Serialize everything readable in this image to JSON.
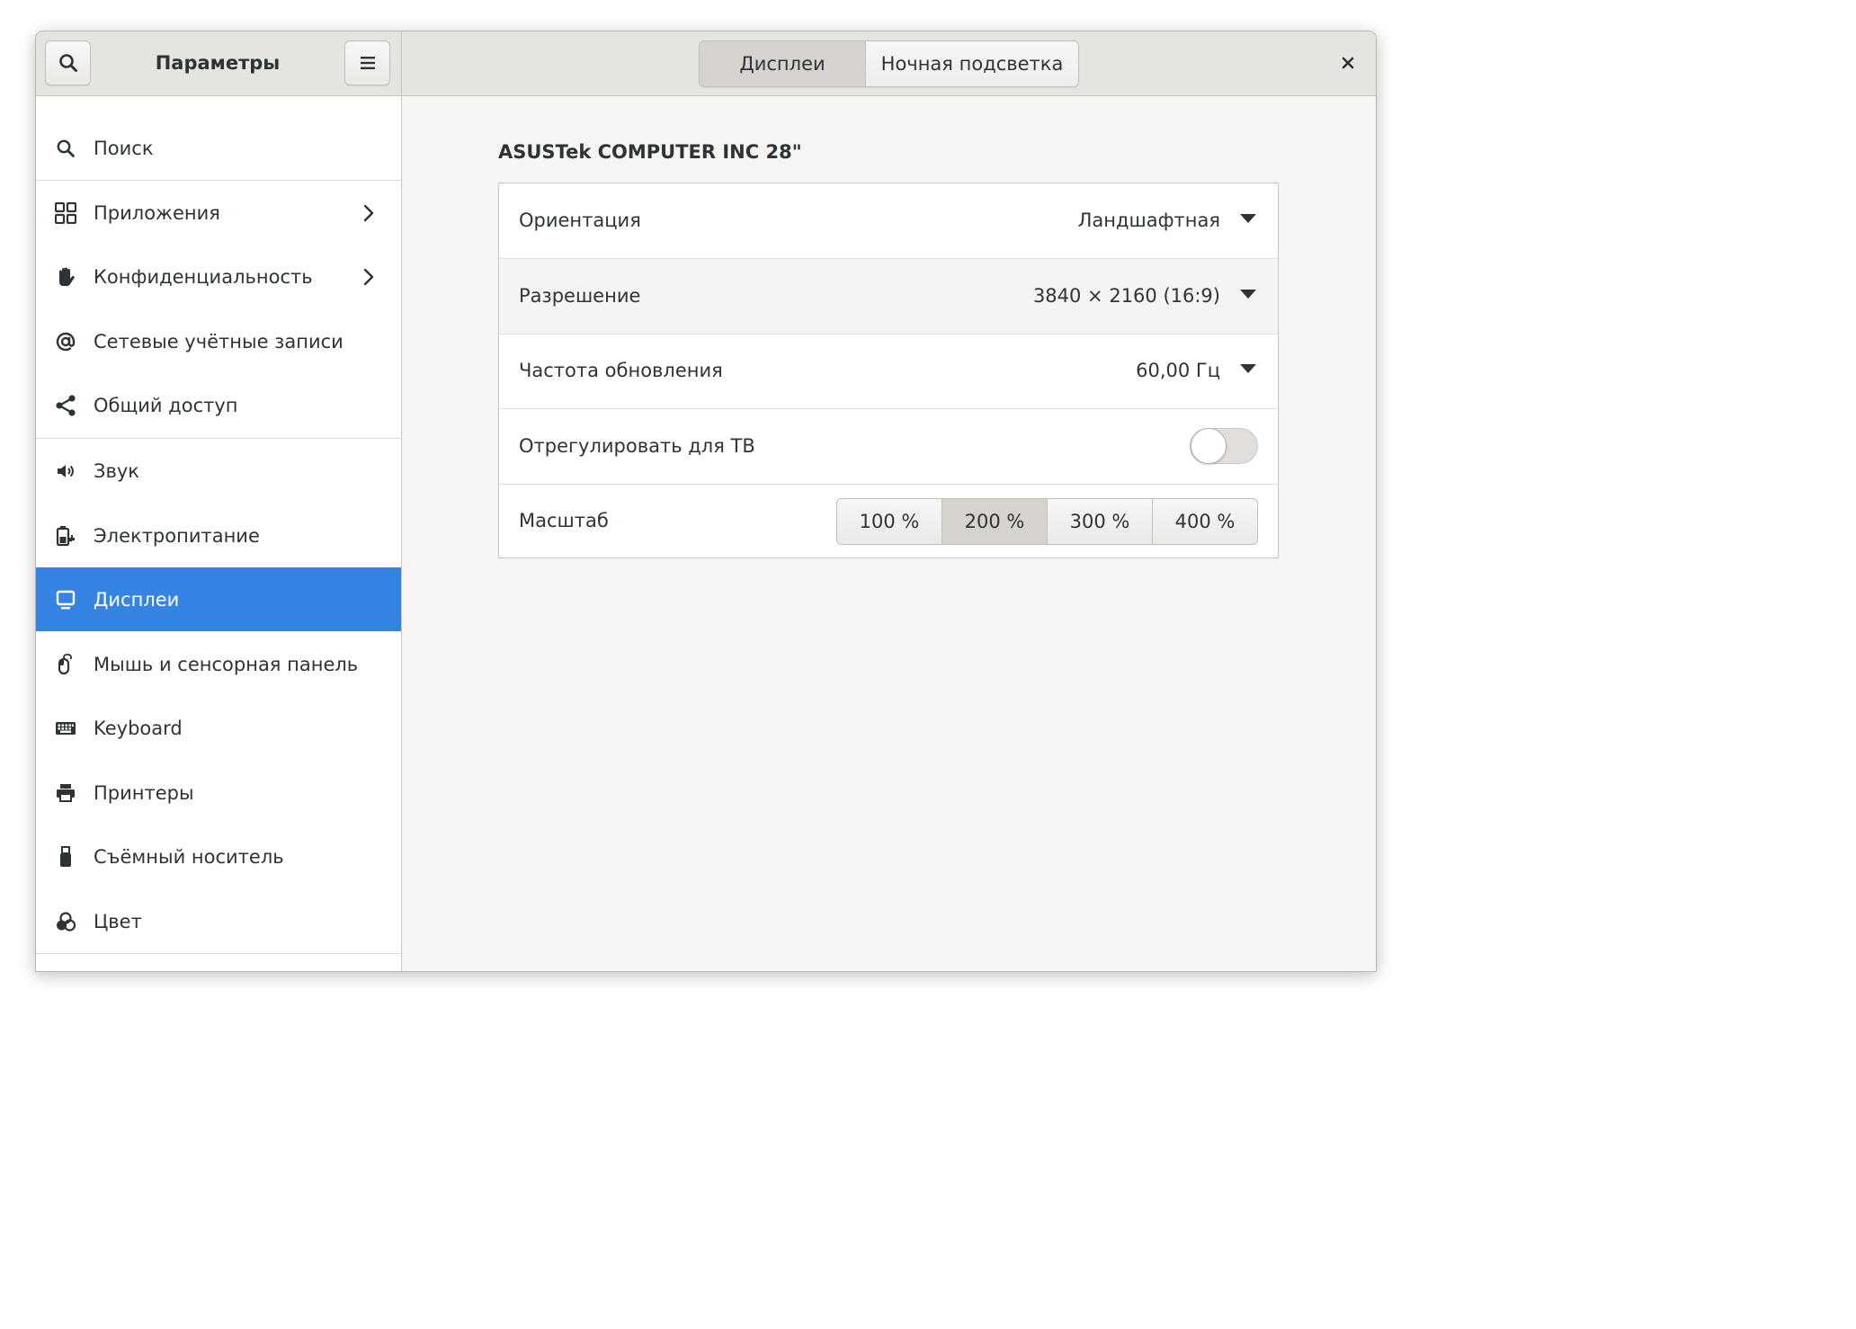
{
  "header": {
    "app_title": "Параметры",
    "tabs": [
      {
        "label": "Дисплеи",
        "active": true
      },
      {
        "label": "Ночная подсветка",
        "active": false
      }
    ]
  },
  "sidebar": {
    "items": [
      {
        "label": "Поиск",
        "icon": "search-icon"
      },
      {
        "label": "Приложения",
        "icon": "grid-icon",
        "has_submenu": true
      },
      {
        "label": "Конфиденциальность",
        "icon": "hand-icon",
        "has_submenu": true
      },
      {
        "label": "Сетевые учётные записи",
        "icon": "at-icon"
      },
      {
        "label": "Общий доступ",
        "icon": "share-icon"
      },
      {
        "label": "Звук",
        "icon": "speaker-icon"
      },
      {
        "label": "Электропитание",
        "icon": "power-icon"
      },
      {
        "label": "Дисплеи",
        "icon": "display-icon",
        "selected": true
      },
      {
        "label": "Мышь и сенсорная панель",
        "icon": "mouse-icon"
      },
      {
        "label": "Keyboard",
        "icon": "keyboard-icon"
      },
      {
        "label": "Принтеры",
        "icon": "printer-icon"
      },
      {
        "label": "Съёмный носитель",
        "icon": "usb-icon"
      },
      {
        "label": "Цвет",
        "icon": "color-icon"
      }
    ]
  },
  "main": {
    "monitor_name": "ASUSTek COMPUTER INC 28\"",
    "rows": {
      "orientation": {
        "label": "Ориентация",
        "value": "Ландшафтная"
      },
      "resolution": {
        "label": "Разрешение",
        "value": "3840 × 2160 (16:9)"
      },
      "refresh": {
        "label": "Частота обновления",
        "value": "60,00 Гц"
      },
      "tv": {
        "label": "Отрегулировать для ТВ",
        "enabled": false
      },
      "scale": {
        "label": "Масштаб",
        "options": [
          "100 %",
          "200 %",
          "300 %",
          "400 %"
        ],
        "selected": "200 %"
      }
    }
  },
  "colors": {
    "accent": "#3584e4",
    "header_bg": "#e6e4e1",
    "window_bg": "#f6f5f4",
    "text": "#2e3436"
  }
}
